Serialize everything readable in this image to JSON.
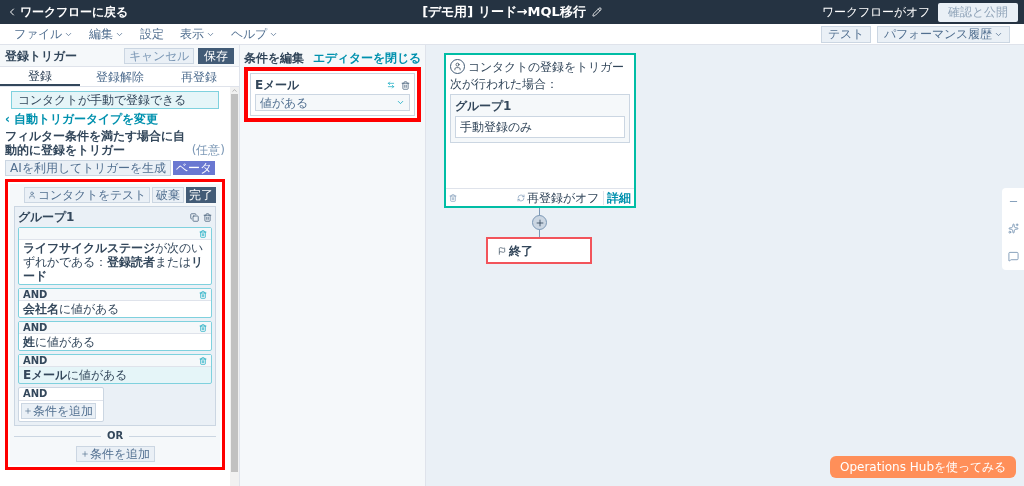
{
  "top_bar": {
    "back_link": "ワークフローに戻る",
    "title": "[デモ用] リード→MQL移行",
    "status": "ワークフローがオフ",
    "publish_button": {
      "label": "確認と公開",
      "disabled": true
    }
  },
  "menu": [
    {
      "label": "ファイル",
      "has_dropdown": true
    },
    {
      "label": "編集",
      "has_dropdown": true
    },
    {
      "label": "設定",
      "has_dropdown": false
    },
    {
      "label": "表示",
      "has_dropdown": true
    },
    {
      "label": "ヘルプ",
      "has_dropdown": true
    }
  ],
  "toolbar_buttons": [
    {
      "label": "テスト",
      "has_dropdown": false
    },
    {
      "label": "パフォーマンス履歴",
      "has_dropdown": true
    }
  ],
  "trigger_panel": {
    "title": "登録トリガー",
    "cancel_button": "キャンセル",
    "save_button": "保存",
    "tabs": [
      {
        "label": "登録",
        "selected": true
      },
      {
        "label": "登録解除",
        "selected": false
      },
      {
        "label": "再登録",
        "selected": false
      }
    ],
    "info": "コンタクトが手動で登録できる",
    "change_link": "‹ 自動トリガータイプを変更",
    "heading": "フィルター条件を満たす場合に自動的に登録をトリガー",
    "optional": "(任意)",
    "ai_button": "AIを利用してトリガーを生成",
    "beta_badge": "ベータ",
    "filter": {
      "highlighted": true,
      "test_button": "コンタクトをテスト",
      "discard_button": "破棄",
      "done_button": "完了",
      "group_title": "グループ1",
      "conditions": [
        {
          "text": "**ライフサイクルステージ**が次のいずれかである：**登録読者**または**リード**",
          "selected": false
        },
        {
          "connector": "AND",
          "text": "**会社名**に値がある",
          "selected": false
        },
        {
          "connector": "AND",
          "text": "**姓**に値がある",
          "selected": false
        },
        {
          "connector": "AND",
          "text": "**Eメール**に値がある",
          "selected": true
        }
      ],
      "and_label": "AND",
      "add_condition_button": "条件を追加",
      "or_label": "OR",
      "add_group_button": "条件を追加"
    }
  },
  "editor": {
    "title": "条件を編集",
    "close_link": "エディターを閉じる",
    "highlighted": true,
    "property": "Eメール",
    "operator": "値がある"
  },
  "canvas": {
    "trigger_card": {
      "selected": true,
      "title": "コンタクトの登録をトリガー",
      "subtitle": "次が行われた場合：",
      "group_title": "グループ1",
      "items": [
        "手動登録のみ"
      ],
      "reenroll": "再登録がオフ",
      "details_link": "詳細"
    },
    "end_node": {
      "label": "終了",
      "highlighted": true
    }
  },
  "promo_button": "Operations Hubを使ってみる"
}
